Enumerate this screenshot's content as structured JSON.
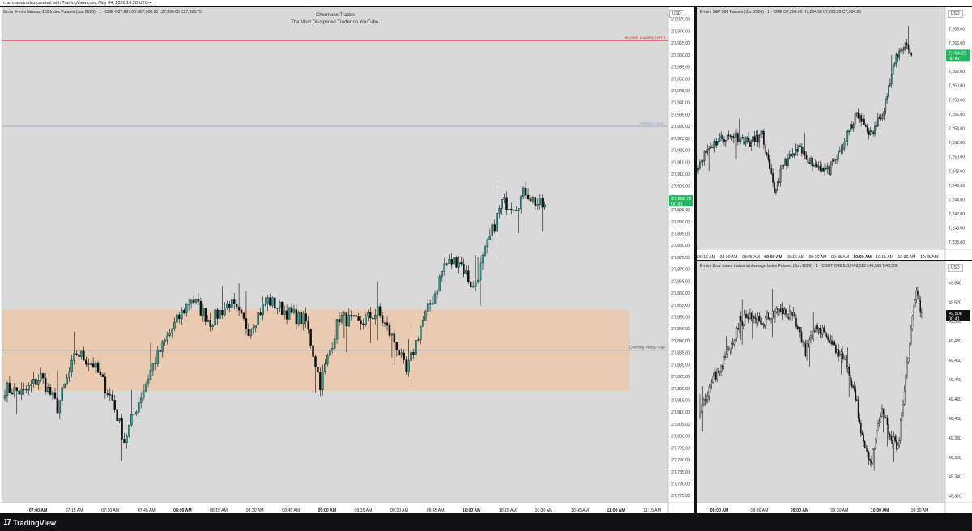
{
  "header": {
    "credit": "chermanetrades created with TradingView.com, May 04, 2026 10:28 UTC-4"
  },
  "footer": {
    "brand": "TradingView",
    "brand_mark": "17"
  },
  "main": {
    "legend": "Micro E-mini Nasdaq-100 Index Futures (Jun 2026) · 1 · CME  O27,897.00  H27,900.25  L27,890.00  C27,898.75",
    "currency": "USD",
    "watermark_title": "Chermane Trades",
    "watermark_sub": "The Most Disciplined Trader on YouTube.",
    "price_tag": "27,898.75",
    "countdown": "00:41"
  },
  "es": {
    "legend": "E-mini S&P 500 Futures (Jun 2026) · 1 · CME  O7,264.00  H7,264.50  L7,263.25  C7,264.25",
    "currency": "USD",
    "price_tag": "7,264.25",
    "countdown": "00:41"
  },
  "ym": {
    "legend": "E-mini Dow Jones Industrial Average Index Futures (Jun 2026) · 1 · CBOT  O49,511  H49,512  L49,506  C49,506",
    "currency": "USD",
    "price_tag": "49,506",
    "countdown": "00:41"
  },
  "chart_data": [
    {
      "type": "candlestick",
      "name": "Micro E-mini Nasdaq-100 Index Futures (Jun 2026)",
      "interval": "1",
      "ylim": [
        27772,
        27980
      ],
      "yticks": [
        "27,775.00",
        "27,780.00",
        "27,785.00",
        "27,790.00",
        "27,795.00",
        "27,800.00",
        "27,805.00",
        "27,810.00",
        "27,815.00",
        "27,820.00",
        "27,825.00",
        "27,830.00",
        "27,835.00",
        "27,840.00",
        "27,845.00",
        "27,850.00",
        "27,855.00",
        "27,860.00",
        "27,865.00",
        "27,870.00",
        "27,875.00",
        "27,880.00",
        "27,885.00",
        "27,890.00",
        "27,895.00",
        "27,900.00",
        "27,905.00",
        "27,910.00",
        "27,915.00",
        "27,920.00",
        "27,925.00",
        "27,930.00",
        "27,935.00",
        "27,940.00",
        "27,945.00",
        "27,950.00",
        "27,955.00",
        "27,960.00",
        "27,965.00",
        "27,970.00",
        "27,975.00"
      ],
      "xticks": [
        {
          "label": "07:00 AM",
          "bold": true
        },
        {
          "label": "07:15 AM",
          "bold": false
        },
        {
          "label": "07:30 AM",
          "bold": false
        },
        {
          "label": "07:45 AM",
          "bold": false
        },
        {
          "label": "08:00 AM",
          "bold": true
        },
        {
          "label": "08:15 AM",
          "bold": false
        },
        {
          "label": "08:30 AM",
          "bold": false
        },
        {
          "label": "08:45 AM",
          "bold": false
        },
        {
          "label": "09:00 AM",
          "bold": true
        },
        {
          "label": "09:15 AM",
          "bold": false
        },
        {
          "label": "09:30 AM",
          "bold": false
        },
        {
          "label": "09:45 AM",
          "bold": false
        },
        {
          "label": "10:00 AM",
          "bold": true
        },
        {
          "label": "10:15 AM",
          "bold": false
        },
        {
          "label": "10:30 AM",
          "bold": false
        },
        {
          "label": "10:45 AM",
          "bold": false
        },
        {
          "label": "11:00 AM",
          "bold": true
        },
        {
          "label": "11:15 AM",
          "bold": false
        }
      ],
      "anchors": [
        [
          0,
          27820
        ],
        [
          8,
          27818
        ],
        [
          15,
          27825
        ],
        [
          22,
          27812
        ],
        [
          30,
          27835
        ],
        [
          37,
          27830
        ],
        [
          45,
          27815
        ],
        [
          50,
          27798
        ],
        [
          55,
          27812
        ],
        [
          62,
          27830
        ],
        [
          70,
          27845
        ],
        [
          78,
          27858
        ],
        [
          86,
          27848
        ],
        [
          94,
          27856
        ],
        [
          102,
          27845
        ],
        [
          110,
          27857
        ],
        [
          118,
          27852
        ],
        [
          126,
          27848
        ],
        [
          132,
          27822
        ],
        [
          140,
          27850
        ],
        [
          148,
          27847
        ],
        [
          156,
          27852
        ],
        [
          164,
          27838
        ],
        [
          168,
          27826
        ],
        [
          174,
          27846
        ],
        [
          180,
          27860
        ],
        [
          184,
          27872
        ],
        [
          190,
          27874
        ],
        [
          196,
          27862
        ],
        [
          202,
          27880
        ],
        [
          208,
          27898
        ],
        [
          214,
          27897
        ],
        [
          218,
          27903
        ],
        [
          222,
          27898
        ],
        [
          226,
          27896
        ]
      ],
      "levels": [
        {
          "label": "Buyside Liquidity (ATH)",
          "price": 27966,
          "color": "#e0393e"
        },
        {
          "label": "Midnight Open",
          "price": 27930,
          "color": "#9a9fc8"
        },
        {
          "label": "Opening Range Gap",
          "price": 27836,
          "color": "#555555"
        }
      ],
      "zone": {
        "from": 27819,
        "to": 27853,
        "color": "#f4c08e"
      },
      "current_price": 27898.75,
      "colors": {
        "up": "#26a69a",
        "down": "#111111",
        "tag": "#1fb860"
      }
    },
    {
      "type": "candlestick",
      "name": "E-mini S&P 500 Futures (Jun 2026)",
      "interval": "1",
      "ylim": [
        7237,
        7271
      ],
      "yticks": [
        "7,238.00",
        "7,240.00",
        "7,242.00",
        "7,244.00",
        "7,246.00",
        "7,248.00",
        "7,250.00",
        "7,252.00",
        "7,254.00",
        "7,256.00",
        "7,258.00",
        "7,260.00",
        "7,262.00",
        "7,264.00",
        "7,266.00",
        "7,268.00",
        "7,270.00"
      ],
      "xticks": [
        {
          "label": "08:15 AM",
          "bold": false
        },
        {
          "label": "08:30 AM",
          "bold": false
        },
        {
          "label": "08:45 AM",
          "bold": false
        },
        {
          "label": "09:00 AM",
          "bold": true
        },
        {
          "label": "09:15 AM",
          "bold": false
        },
        {
          "label": "09:30 AM",
          "bold": false
        },
        {
          "label": "09:45 AM",
          "bold": false
        },
        {
          "label": "10:00 AM",
          "bold": true
        },
        {
          "label": "10:15 AM",
          "bold": false
        },
        {
          "label": "10:30 AM",
          "bold": false
        },
        {
          "label": "10:45 AM",
          "bold": false
        }
      ],
      "anchors": [
        [
          0,
          7249
        ],
        [
          6,
          7251
        ],
        [
          14,
          7252.5
        ],
        [
          24,
          7253
        ],
        [
          34,
          7252
        ],
        [
          42,
          7253
        ],
        [
          50,
          7245
        ],
        [
          56,
          7249
        ],
        [
          66,
          7251
        ],
        [
          76,
          7249
        ],
        [
          86,
          7248
        ],
        [
          94,
          7251
        ],
        [
          104,
          7256
        ],
        [
          114,
          7253
        ],
        [
          122,
          7257
        ],
        [
          130,
          7264
        ],
        [
          136,
          7266
        ],
        [
          140,
          7264.3
        ]
      ],
      "current_price": 7264.25,
      "colors": {
        "up": "#26a69a",
        "down": "#111111",
        "tag": "#1fb860"
      }
    },
    {
      "type": "candlestick",
      "name": "E-mini Dow Jones Industrial Average Index Futures (Jun 2026)",
      "interval": "1",
      "ylim": [
        49313,
        49562
      ],
      "yticks": [
        "49,320",
        "49,340",
        "49,360",
        "49,380",
        "49,400",
        "49,420",
        "49,440",
        "49,460",
        "49,480",
        "49,500",
        "49,520",
        "49,540",
        "49,560"
      ],
      "xticks": [
        {
          "label": "08:00 AM",
          "bold": true
        },
        {
          "label": "08:30 AM",
          "bold": false
        },
        {
          "label": "09:00 AM",
          "bold": true
        },
        {
          "label": "09:30 AM",
          "bold": false
        },
        {
          "label": "10:00 AM",
          "bold": true
        },
        {
          "label": "10:30 AM",
          "bold": false
        }
      ],
      "anchors": [
        [
          0,
          49410
        ],
        [
          10,
          49440
        ],
        [
          22,
          49470
        ],
        [
          30,
          49500
        ],
        [
          38,
          49505
        ],
        [
          46,
          49498
        ],
        [
          56,
          49508
        ],
        [
          64,
          49510
        ],
        [
          72,
          49505
        ],
        [
          80,
          49470
        ],
        [
          90,
          49495
        ],
        [
          100,
          49478
        ],
        [
          110,
          49460
        ],
        [
          118,
          49420
        ],
        [
          124,
          49375
        ],
        [
          130,
          49355
        ],
        [
          138,
          49410
        ],
        [
          144,
          49380
        ],
        [
          150,
          49370
        ],
        [
          156,
          49440
        ],
        [
          160,
          49490
        ],
        [
          164,
          49530
        ],
        [
          168,
          49506
        ]
      ],
      "current_price": 49506,
      "colors": {
        "up": "#ffffff",
        "down": "#111111",
        "tag": "#111111"
      }
    }
  ]
}
